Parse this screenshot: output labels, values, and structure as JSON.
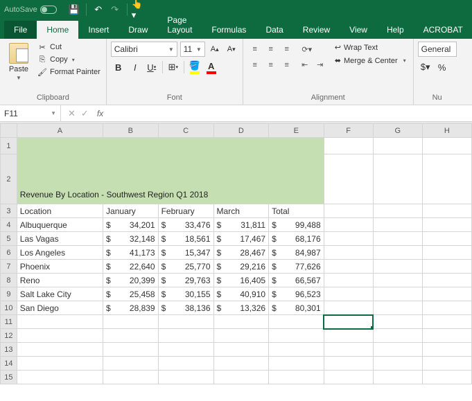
{
  "titlebar": {
    "autosave": "AutoSave"
  },
  "tabs": {
    "file": "File",
    "home": "Home",
    "insert": "Insert",
    "draw": "Draw",
    "pagelayout": "Page Layout",
    "formulas": "Formulas",
    "data": "Data",
    "review": "Review",
    "view": "View",
    "help": "Help",
    "acrobat": "ACROBAT"
  },
  "ribbon": {
    "clipboard": {
      "label": "Clipboard",
      "paste": "Paste",
      "cut": "Cut",
      "copy": "Copy",
      "fmt": "Format Painter"
    },
    "font": {
      "label": "Font",
      "name": "Calibri",
      "size": "11"
    },
    "alignment": {
      "label": "Alignment",
      "wrap": "Wrap Text",
      "merge": "Merge & Center"
    },
    "number": {
      "label": "Nu",
      "general": "General"
    }
  },
  "namebox": "F11",
  "cols": [
    "A",
    "B",
    "C",
    "D",
    "E",
    "F",
    "G",
    "H"
  ],
  "title": "Revenue By Location - Southwest Region Q1 2018",
  "headers": {
    "loc": "Location",
    "jan": "January",
    "feb": "February",
    "mar": "March",
    "tot": "Total"
  },
  "rows": [
    {
      "n": "4",
      "loc": "Albuquerque",
      "jan": "34,201",
      "feb": "33,476",
      "mar": "31,811",
      "tot": "99,488"
    },
    {
      "n": "5",
      "loc": "Las Vagas",
      "jan": "32,148",
      "feb": "18,561",
      "mar": "17,467",
      "tot": "68,176"
    },
    {
      "n": "6",
      "loc": "Los Angeles",
      "jan": "41,173",
      "feb": "15,347",
      "mar": "28,467",
      "tot": "84,987"
    },
    {
      "n": "7",
      "loc": "Phoenix",
      "jan": "22,640",
      "feb": "25,770",
      "mar": "29,216",
      "tot": "77,626"
    },
    {
      "n": "8",
      "loc": "Reno",
      "jan": "20,399",
      "feb": "29,763",
      "mar": "16,405",
      "tot": "66,567"
    },
    {
      "n": "9",
      "loc": "Salt Lake City",
      "jan": "25,458",
      "feb": "30,155",
      "mar": "40,910",
      "tot": "96,523"
    },
    {
      "n": "10",
      "loc": "San Diego",
      "jan": "28,839",
      "feb": "38,136",
      "mar": "13,326",
      "tot": "80,301"
    }
  ]
}
